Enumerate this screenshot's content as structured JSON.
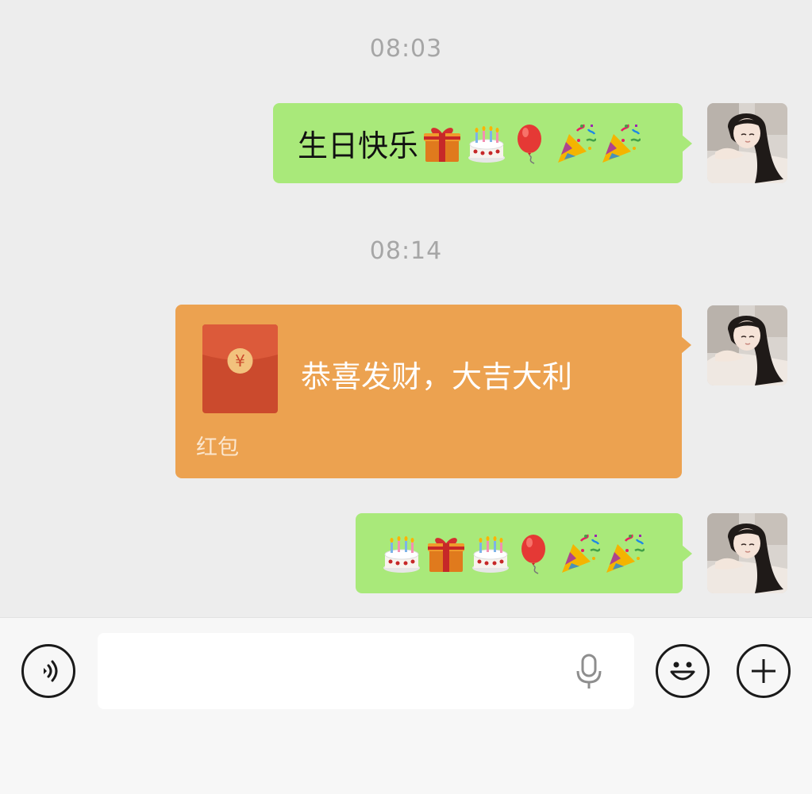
{
  "chat": {
    "messages": [
      {
        "timestamp": "08:03",
        "type": "text",
        "text": "生日快乐",
        "emojis": [
          "gift",
          "cake",
          "balloon",
          "party-popper",
          "party-popper"
        ]
      },
      {
        "timestamp": "08:14",
        "type": "red-packet",
        "greeting": "恭喜发财，大吉大利",
        "label": "红包",
        "currency_symbol": "¥"
      },
      {
        "type": "emoji",
        "emojis": [
          "cake",
          "gift",
          "cake",
          "balloon",
          "party-popper",
          "party-popper"
        ]
      }
    ]
  },
  "input_bar": {
    "text_value": "",
    "icons": {
      "voice": "voice-icon",
      "mic": "microphone-icon",
      "emoji": "smiley-icon",
      "more": "plus-icon"
    }
  },
  "colors": {
    "background": "#ededed",
    "sent_bubble": "#a9e97a",
    "red_packet_bubble": "#eca250",
    "red_packet_card": "#d8492f",
    "timestamp_text": "#a6a6a6",
    "input_bar": "#f7f7f7"
  }
}
